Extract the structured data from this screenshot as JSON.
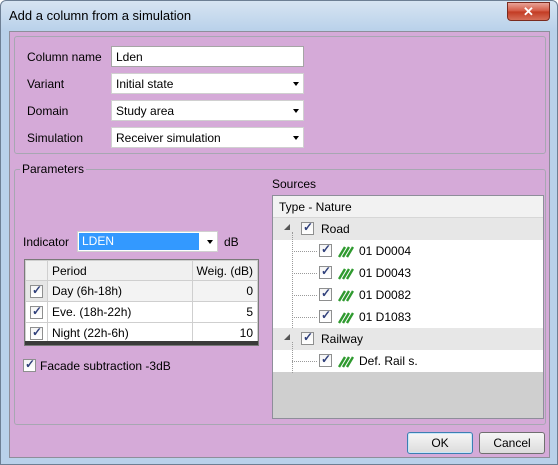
{
  "window": {
    "title": "Add a column from a simulation",
    "close_glyph": "✕"
  },
  "form": {
    "column_name_label": "Column name",
    "column_name_value": "Lden",
    "variant_label": "Variant",
    "variant_value": "Initial state",
    "domain_label": "Domain",
    "domain_value": "Study area",
    "simulation_label": "Simulation",
    "simulation_value": "Receiver simulation"
  },
  "parameters": {
    "title": "Parameters",
    "indicator_label": "Indicator",
    "indicator_value": "LDEN",
    "indicator_unit": "dB",
    "grid": {
      "headers": [
        "Period",
        "Weig. (dB)"
      ],
      "rows": [
        {
          "checked": true,
          "period": "Day (6h-18h)",
          "weight": "0"
        },
        {
          "checked": true,
          "period": "Eve. (18h-22h)",
          "weight": "5"
        },
        {
          "checked": true,
          "period": "Night (22h-6h)",
          "weight": "10"
        }
      ]
    },
    "facade_label": "Facade subtraction -3dB",
    "facade_checked": true
  },
  "sources": {
    "title": "Sources",
    "header": "Type - Nature",
    "groups": [
      {
        "name": "Road",
        "checked": true,
        "items": [
          {
            "name": "01 D0004",
            "checked": true
          },
          {
            "name": "01 D0043",
            "checked": true
          },
          {
            "name": "01 D0082",
            "checked": true
          },
          {
            "name": "01 D1083",
            "checked": true
          }
        ]
      },
      {
        "name": "Railway",
        "checked": true,
        "items": [
          {
            "name": "Def. Rail s.",
            "checked": true
          }
        ]
      }
    ]
  },
  "buttons": {
    "ok": "OK",
    "cancel": "Cancel"
  },
  "colors": {
    "client_bg": "#d5aad8",
    "selection": "#3399ff",
    "road_icon": "#2f9a2f"
  }
}
